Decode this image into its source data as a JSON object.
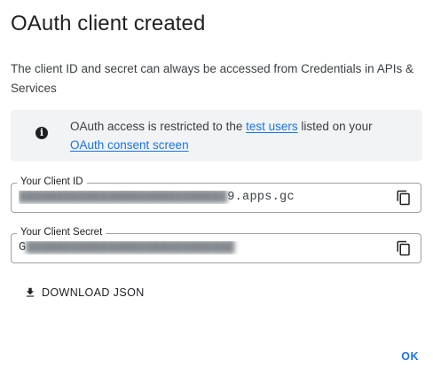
{
  "dialog": {
    "title": "OAuth client created",
    "description": "The client ID and secret can always be accessed from Credentials in APIs & Services"
  },
  "info": {
    "icon": "info-icon",
    "text_before": "OAuth access is restricted to the ",
    "link_test_users": "test users",
    "text_middle": " listed on your ",
    "link_consent": "OAuth consent screen"
  },
  "client_id": {
    "label": "Your Client ID",
    "value_redacted": "                                     ",
    "value_visible_end": "9.apps.gc",
    "copy_icon": "copy-icon"
  },
  "client_secret": {
    "label": "Your Client Secret",
    "value_visible_start": "G",
    "value_redacted": "                                      ",
    "copy_icon": "copy-icon"
  },
  "actions": {
    "download_label": "DOWNLOAD JSON",
    "download_icon": "download-icon",
    "ok_label": "OK"
  },
  "colors": {
    "accent": "#1a73e8",
    "info_bg": "#f1f3f4",
    "border": "#9aa0a6"
  }
}
